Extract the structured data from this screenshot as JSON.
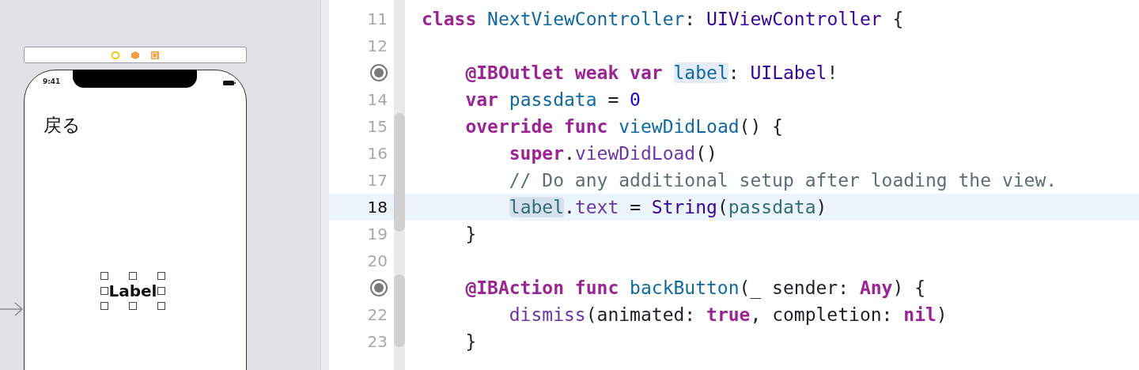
{
  "canvas": {
    "status_time": "9:41",
    "back_button": "戻る",
    "label": {
      "text": "Label",
      "selected": true
    }
  },
  "editor": {
    "lines": [
      {
        "kind": "numbered",
        "number": "11",
        "current": false,
        "tokens": [
          {
            "text": "class",
            "kind": "keyword"
          },
          {
            "text": " NextViewController",
            "kind": "decl"
          },
          {
            "text": ": ",
            "kind": "plain"
          },
          {
            "text": "UIViewController",
            "kind": "type"
          },
          {
            "text": " {",
            "kind": "plain"
          }
        ]
      },
      {
        "kind": "numbered",
        "number": "12",
        "current": false
      },
      {
        "kind": "connection",
        "current": false,
        "tokens": [
          {
            "text": "    @IBOutlet weak var ",
            "kind": "keyword"
          },
          {
            "text": "label",
            "kind": "decl",
            "highlighted": true
          },
          {
            "text": ": ",
            "kind": "plain"
          },
          {
            "text": "UILabel",
            "kind": "type"
          },
          {
            "text": "!",
            "kind": "plain"
          }
        ]
      },
      {
        "kind": "numbered",
        "number": "14",
        "current": false,
        "tokens": [
          {
            "text": "    var",
            "kind": "keyword"
          },
          {
            "text": " passdata",
            "kind": "decl"
          },
          {
            "text": " = ",
            "kind": "plain"
          },
          {
            "text": "0",
            "kind": "number"
          }
        ]
      },
      {
        "kind": "numbered",
        "number": "15",
        "current": false,
        "tokens": [
          {
            "text": "    override func",
            "kind": "keyword"
          },
          {
            "text": " viewDidLoad",
            "kind": "decl"
          },
          {
            "text": "() {",
            "kind": "plain"
          }
        ]
      },
      {
        "kind": "numbered",
        "number": "16",
        "current": false,
        "tokens": [
          {
            "text": "        super",
            "kind": "keyword"
          },
          {
            "text": ".",
            "kind": "plain"
          },
          {
            "text": "viewDidLoad",
            "kind": "method"
          },
          {
            "text": "()",
            "kind": "plain"
          }
        ]
      },
      {
        "kind": "numbered",
        "number": "17",
        "current": false,
        "tokens": [
          {
            "text": "        // Do any additional setup after loading the view.",
            "kind": "comment"
          }
        ]
      },
      {
        "kind": "numbered",
        "number": "18",
        "current": true,
        "tokens": [
          {
            "text": "        label",
            "kind": "member",
            "highlighted": true
          },
          {
            "text": ".",
            "kind": "plain"
          },
          {
            "text": "text",
            "kind": "method"
          },
          {
            "text": " = ",
            "kind": "plain"
          },
          {
            "text": "String",
            "kind": "type"
          },
          {
            "text": "(",
            "kind": "plain"
          },
          {
            "text": "passdata",
            "kind": "member"
          },
          {
            "text": ")",
            "kind": "plain"
          }
        ]
      },
      {
        "kind": "numbered",
        "number": "19",
        "current": false,
        "tokens": [
          {
            "text": "    }",
            "kind": "plain"
          }
        ]
      },
      {
        "kind": "numbered",
        "number": "20",
        "current": false
      },
      {
        "kind": "connection",
        "current": false,
        "tokens": [
          {
            "text": "    @IBAction func",
            "kind": "keyword"
          },
          {
            "text": " backButton",
            "kind": "decl"
          },
          {
            "text": "(_ sender: ",
            "kind": "plain"
          },
          {
            "text": "Any",
            "kind": "keyword"
          },
          {
            "text": ") {",
            "kind": "plain"
          }
        ]
      },
      {
        "kind": "numbered",
        "number": "22",
        "current": false,
        "tokens": [
          {
            "text": "        dismiss",
            "kind": "method"
          },
          {
            "text": "(animated: ",
            "kind": "plain"
          },
          {
            "text": "true",
            "kind": "keyword"
          },
          {
            "text": ", completion: ",
            "kind": "plain"
          },
          {
            "text": "nil",
            "kind": "keyword"
          },
          {
            "text": ")",
            "kind": "plain"
          }
        ]
      },
      {
        "kind": "numbered",
        "number": "23",
        "current": false,
        "tokens": [
          {
            "text": "    }",
            "kind": "plain"
          }
        ]
      }
    ]
  }
}
